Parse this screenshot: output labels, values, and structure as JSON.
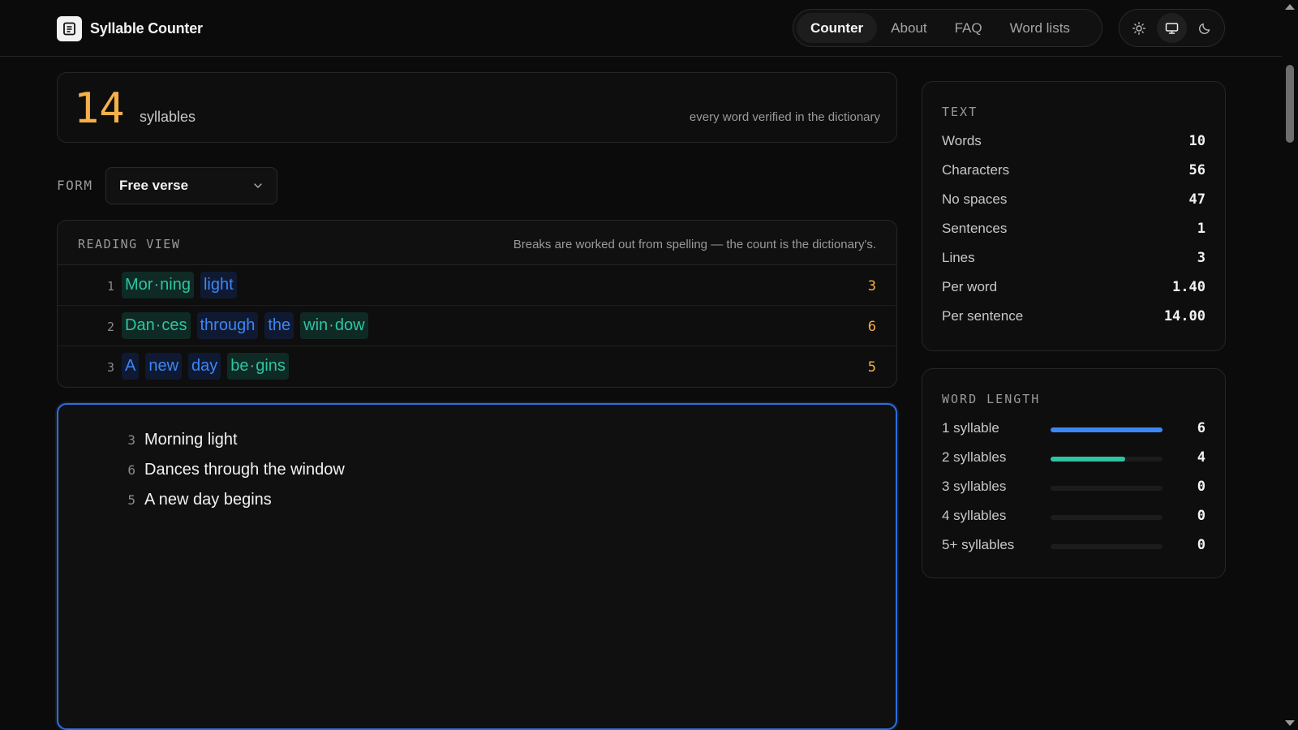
{
  "header": {
    "app_title": "Syllable Counter",
    "nav": [
      {
        "label": "Counter",
        "active": true
      },
      {
        "label": "About",
        "active": false
      },
      {
        "label": "FAQ",
        "active": false
      },
      {
        "label": "Word lists",
        "active": false
      }
    ],
    "theme_buttons": [
      "sun-icon",
      "monitor-icon",
      "moon-icon"
    ],
    "theme_selected": "monitor-icon"
  },
  "summary": {
    "count": "14",
    "unit": "syllables",
    "verified_note": "every word verified in the dictionary"
  },
  "form": {
    "label": "FORM",
    "selected": "Free verse"
  },
  "reading_view": {
    "title": "READING VIEW",
    "note": "Breaks are worked out from spelling — the count is the dictionary's.",
    "lines": [
      {
        "num": "1",
        "count": "3",
        "words": [
          {
            "parts": [
              "Mor",
              "ning"
            ],
            "color": "teal"
          },
          {
            "parts": [
              "light"
            ],
            "color": "blue"
          }
        ]
      },
      {
        "num": "2",
        "count": "6",
        "words": [
          {
            "parts": [
              "Dan",
              "ces"
            ],
            "color": "teal"
          },
          {
            "parts": [
              "through"
            ],
            "color": "blue"
          },
          {
            "parts": [
              "the"
            ],
            "color": "blue"
          },
          {
            "parts": [
              "win",
              "dow"
            ],
            "color": "teal"
          }
        ]
      },
      {
        "num": "3",
        "count": "5",
        "words": [
          {
            "parts": [
              "A"
            ],
            "color": "blue"
          },
          {
            "parts": [
              "new"
            ],
            "color": "blue"
          },
          {
            "parts": [
              "day"
            ],
            "color": "blue"
          },
          {
            "parts": [
              "be",
              "gins"
            ],
            "color": "teal"
          }
        ]
      }
    ]
  },
  "editor": {
    "lines": [
      {
        "count": "3",
        "text": "Morning light"
      },
      {
        "count": "6",
        "text": "Dances through the window"
      },
      {
        "count": "5",
        "text": "A new day begins"
      }
    ]
  },
  "text_stats": {
    "title": "TEXT",
    "rows": [
      {
        "label": "Words",
        "value": "10"
      },
      {
        "label": "Characters",
        "value": "56"
      },
      {
        "label": "No spaces",
        "value": "47"
      },
      {
        "label": "Sentences",
        "value": "1"
      },
      {
        "label": "Lines",
        "value": "3"
      },
      {
        "label": "Per word",
        "value": "1.40"
      },
      {
        "label": "Per sentence",
        "value": "14.00"
      }
    ]
  },
  "word_length": {
    "title": "WORD LENGTH",
    "rows": [
      {
        "label": "1 syllable",
        "value": "6",
        "fraction": 1.0,
        "color": "#3d86f5"
      },
      {
        "label": "2 syllables",
        "value": "4",
        "fraction": 0.667,
        "color": "#2ec4a3"
      },
      {
        "label": "3 syllables",
        "value": "0",
        "fraction": 0,
        "color": "#3d86f5"
      },
      {
        "label": "4 syllables",
        "value": "0",
        "fraction": 0,
        "color": "#3d86f5"
      },
      {
        "label": "5+ syllables",
        "value": "0",
        "fraction": 0,
        "color": "#3d86f5"
      }
    ]
  },
  "colors": {
    "accent_orange": "#f5b04a",
    "teal": "#2ec4a3",
    "blue": "#3d86f5",
    "focus_border": "#2d6fe0"
  }
}
